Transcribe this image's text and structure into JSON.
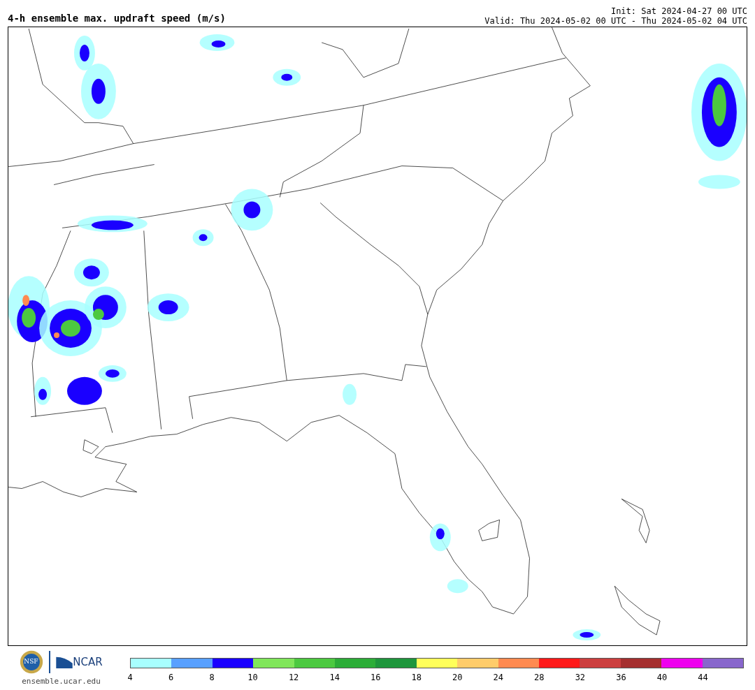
{
  "header": {
    "title": "4-h ensemble max. updraft speed (m/s)",
    "init": "Init: Sat 2024-04-27 00 UTC",
    "valid": "Valid: Thu 2024-05-02 00 UTC - Thu 2024-05-02 04 UTC"
  },
  "logos": {
    "seal_text": "NSF",
    "org_text": "NCAR",
    "url": "ensemble.ucar.edu"
  },
  "colorbar": {
    "bins": [
      {
        "color": "#a8ffff"
      },
      {
        "color": "#58a0ff"
      },
      {
        "color": "#1a00ff"
      },
      {
        "color": "#80e65a"
      },
      {
        "color": "#4cc940"
      },
      {
        "color": "#2cad38"
      },
      {
        "color": "#1e963c"
      },
      {
        "color": "#ffff5a"
      },
      {
        "color": "#ffcc6a"
      },
      {
        "color": "#ff8a50"
      },
      {
        "color": "#ff1a1a"
      },
      {
        "color": "#cc3f3f"
      },
      {
        "color": "#a52f2f"
      },
      {
        "color": "#ee00ee"
      },
      {
        "color": "#8866cc"
      }
    ],
    "ticks": [
      "4",
      "6",
      "8",
      "10",
      "12",
      "14",
      "16",
      "18",
      "20",
      "24",
      "28",
      "32",
      "36",
      "40",
      "44"
    ]
  }
}
